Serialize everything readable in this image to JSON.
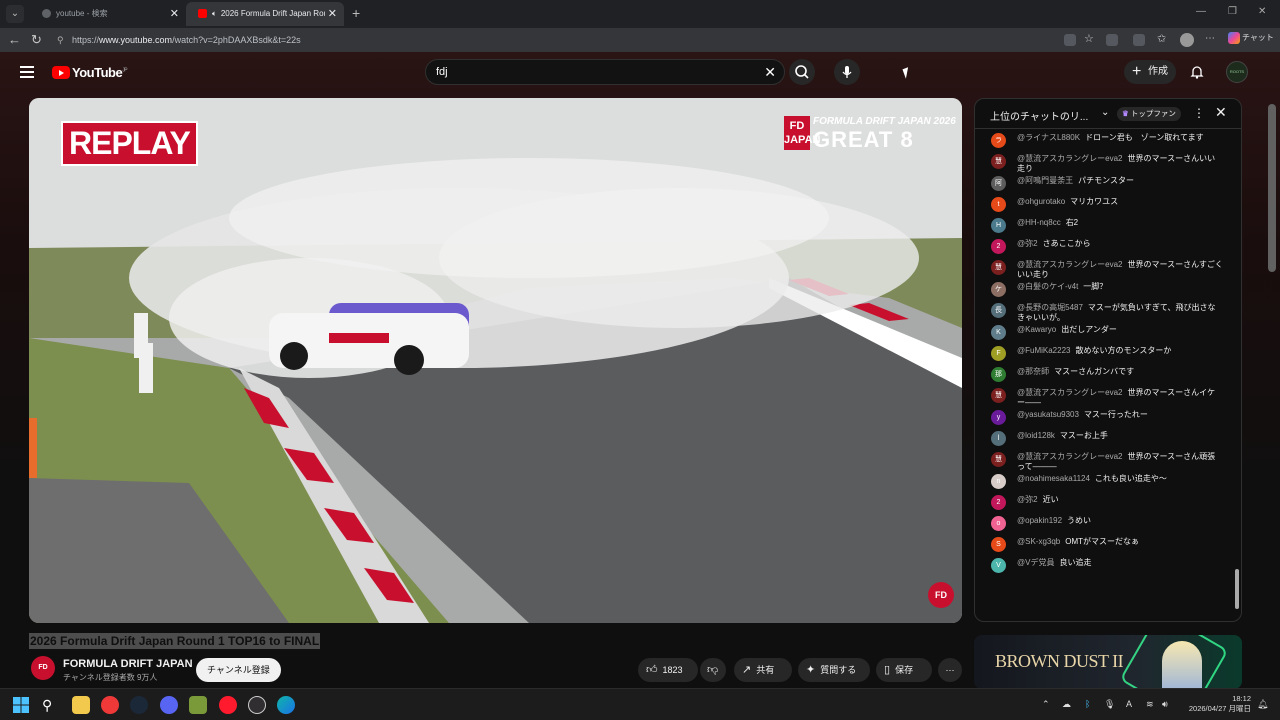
{
  "browser": {
    "tabs": [
      {
        "label": "youtube - 検索"
      },
      {
        "label": "2026 Formula Drift Japan Rou"
      }
    ],
    "url_prefix": "https://",
    "url_host": "www.youtube.com",
    "url_rest": "/watch?v=2phDAAXBsdk&t=22s",
    "copilot_label": "チャット"
  },
  "youtube": {
    "logo_text": "YouTube",
    "logo_region": "JP",
    "search_value": "fdj",
    "create_label": "作成",
    "avatar_text": "ROOTS"
  },
  "video": {
    "replay_label": "REPLAY",
    "badge_short": "FD JAPAN",
    "badge_line1": "FORMULA DRIFT JAPAN 2026",
    "badge_line2": "GREAT 8",
    "corner_logo": "FD",
    "title": "2026 Formula Drift Japan Round 1 TOP16 to FINAL",
    "channel_name": "FORMULA DRIFT JAPAN",
    "channel_subs": "チャンネル登録者数 9万人",
    "channel_avatar": "FD",
    "subscribe_label": "チャンネル登録",
    "like_count": "1823",
    "share_label": "共有",
    "ask_label": "質問する",
    "save_label": "保存"
  },
  "chat": {
    "title": "上位のチャットのリ...",
    "tag": "トップファン",
    "messages": [
      {
        "author": "@ライナスL880K",
        "text": "ドローン君も　ゾーン取れてます",
        "color": "#e64a19",
        "initial": "ラ"
      },
      {
        "author": "@慧流アスカラングレーeva2",
        "text": "世界のマースーさんいい走り",
        "color": "#7b1f1f",
        "initial": "慧"
      },
      {
        "author": "@阿鳴門曼荼王",
        "text": "パチモンスター",
        "color": "#5d5d5d",
        "initial": "阿"
      },
      {
        "author": "@ohgurotako",
        "text": "マリカワユス",
        "color": "#e64a19",
        "initial": "t"
      },
      {
        "author": "@HH-nq8cc",
        "text": "右2",
        "color": "#4a7a8c",
        "initial": "H"
      },
      {
        "author": "@弥2",
        "text": "さあここから",
        "color": "#c2185b",
        "initial": "2"
      },
      {
        "author": "@慧流アスカラングレーeva2",
        "text": "世界のマースーさんすごくいい走り",
        "color": "#7b1f1f",
        "initial": "慧"
      },
      {
        "author": "@白髪のケイ-v4t",
        "text": "一脚？",
        "color": "#8d6e63",
        "initial": "ケ"
      },
      {
        "author": "@長野の高堀5487",
        "text": "マスーが気負いすぎて、飛び出さなきゃいいが。",
        "color": "#546e7a",
        "initial": "長"
      },
      {
        "author": "@Kawaryo",
        "text": "出だしアンダー",
        "color": "#607d8b",
        "initial": "K"
      },
      {
        "author": "@FuMiKa2223",
        "text": "散めない方のモンスターか",
        "color": "#9e9d24",
        "initial": "F"
      },
      {
        "author": "@那奈師",
        "text": "マスーさんガンバです",
        "color": "#2e7d32",
        "initial": "那"
      },
      {
        "author": "@慧流アスカラングレーeva2",
        "text": "世界のマースーさんイケー――",
        "color": "#7b1f1f",
        "initial": "慧"
      },
      {
        "author": "@yasukatsu9303",
        "text": "マスー行ったれー",
        "color": "#6a1b9a",
        "initial": "y"
      },
      {
        "author": "@loid128k",
        "text": "マスーお上手",
        "color": "#546e7a",
        "initial": "l"
      },
      {
        "author": "@慧流アスカラングレーeva2",
        "text": "世界のマースーさん頑張って―――",
        "color": "#7b1f1f",
        "initial": "慧"
      },
      {
        "author": "@noahimesaka1124",
        "text": "これも良い追走や～",
        "color": "#d7ccc8",
        "initial": "n"
      },
      {
        "author": "@弥2",
        "text": "近い",
        "color": "#c2185b",
        "initial": "2"
      },
      {
        "author": "@opakin192",
        "text": "うめい",
        "color": "#f06292",
        "initial": "o"
      },
      {
        "author": "@SK-xg3qb",
        "text": "OMTがマスーだなぁ",
        "color": "#e64a19",
        "initial": "S"
      },
      {
        "author": "@Vデ党員",
        "text": "良い追走",
        "color": "#4db6ac",
        "initial": "V"
      }
    ]
  },
  "ad": {
    "text": "BROWN DUST II"
  },
  "taskbar": {
    "time": "18:12",
    "date": "2026/04/27 月曜日",
    "ime": "A"
  }
}
